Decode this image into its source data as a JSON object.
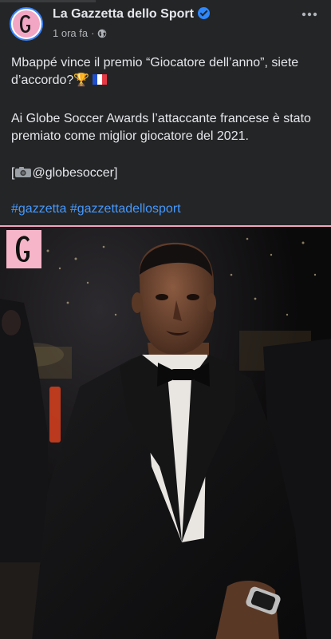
{
  "post": {
    "page_name": "La Gazzetta dello Sport",
    "time": "1 ora fa",
    "separator": "·",
    "text_line1": "Mbappé vince il premio “Giocatore dell’anno”, siete d’accordo?",
    "text_line2": "Ai Globe Soccer Awards l’attaccante francese è stato premiato come miglior giocatore del 2021.",
    "credit": "@globesoccer",
    "credit_open": "[",
    "credit_close": "]",
    "hashtag1": "#gazzetta",
    "hashtag2": "#gazzettadellosport"
  },
  "logo_letter": "G",
  "icons": {
    "verified": "verified-badge-icon",
    "privacy": "globe-icon",
    "more": "more-horizontal-icon",
    "trophy": "trophy-emoji",
    "flag": "france-flag-emoji",
    "camera": "camera-emoji"
  },
  "colors": {
    "background": "#242526",
    "text": "#e4e6eb",
    "secondary": "#b0b3b8",
    "hashtag": "#4599ff",
    "verified": "#2d88ff",
    "brand_pink": "#f6b5c8"
  }
}
